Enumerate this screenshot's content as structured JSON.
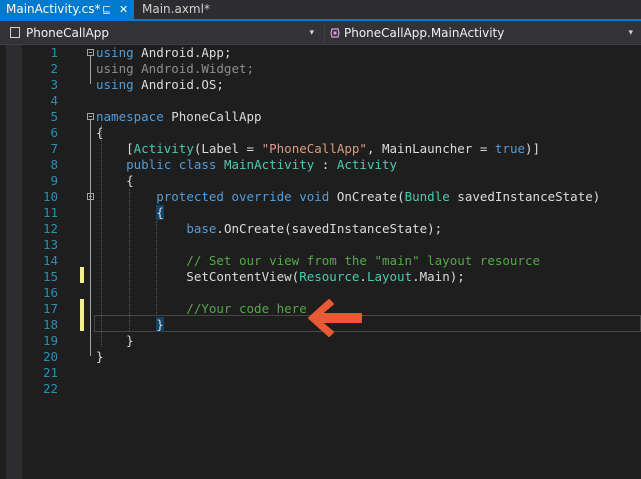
{
  "tabs": [
    {
      "label": "MainActivity.cs*",
      "active": true
    },
    {
      "label": "Main.axml*",
      "active": false
    }
  ],
  "tab_icons": {
    "pin": "⊑",
    "close": "✕"
  },
  "nav": {
    "left_label": "PhoneCallApp",
    "right_label": "PhoneCallApp.MainActivity",
    "chevron": "▾"
  },
  "lines": [
    {
      "n": "1",
      "text": "using Android.App;"
    },
    {
      "n": "2",
      "text": "using Android.Widget;"
    },
    {
      "n": "3",
      "text": "using Android.OS;"
    },
    {
      "n": "4",
      "text": ""
    },
    {
      "n": "5",
      "text": "namespace PhoneCallApp"
    },
    {
      "n": "6",
      "text": "{"
    },
    {
      "n": "7",
      "text": "    [Activity(Label = \"PhoneCallApp\", MainLauncher = true)]"
    },
    {
      "n": "8",
      "text": "    public class MainActivity : Activity"
    },
    {
      "n": "9",
      "text": "    {"
    },
    {
      "n": "10",
      "text": "        protected override void OnCreate(Bundle savedInstanceState)"
    },
    {
      "n": "11",
      "text": "        {"
    },
    {
      "n": "12",
      "text": "            base.OnCreate(savedInstanceState);"
    },
    {
      "n": "13",
      "text": ""
    },
    {
      "n": "14",
      "text": "            // Set our view from the \"main\" layout resource"
    },
    {
      "n": "15",
      "text": "            SetContentView(Resource.Layout.Main);"
    },
    {
      "n": "16",
      "text": ""
    },
    {
      "n": "17",
      "text": "            //Your code here"
    },
    {
      "n": "18",
      "text": "        }"
    },
    {
      "n": "19",
      "text": "    }"
    },
    {
      "n": "20",
      "text": "}"
    },
    {
      "n": "21",
      "text": ""
    },
    {
      "n": "22",
      "text": ""
    }
  ],
  "colors": {
    "keyword": "#569cd6",
    "type": "#4ec9b0",
    "string": "#d69d85",
    "comment": "#57a64a",
    "line_number": "#2b91af",
    "accent": "#007acc",
    "arrow": "#e85a35"
  },
  "annotation": {
    "icon": "left-arrow-icon",
    "points_to_line": "17"
  }
}
